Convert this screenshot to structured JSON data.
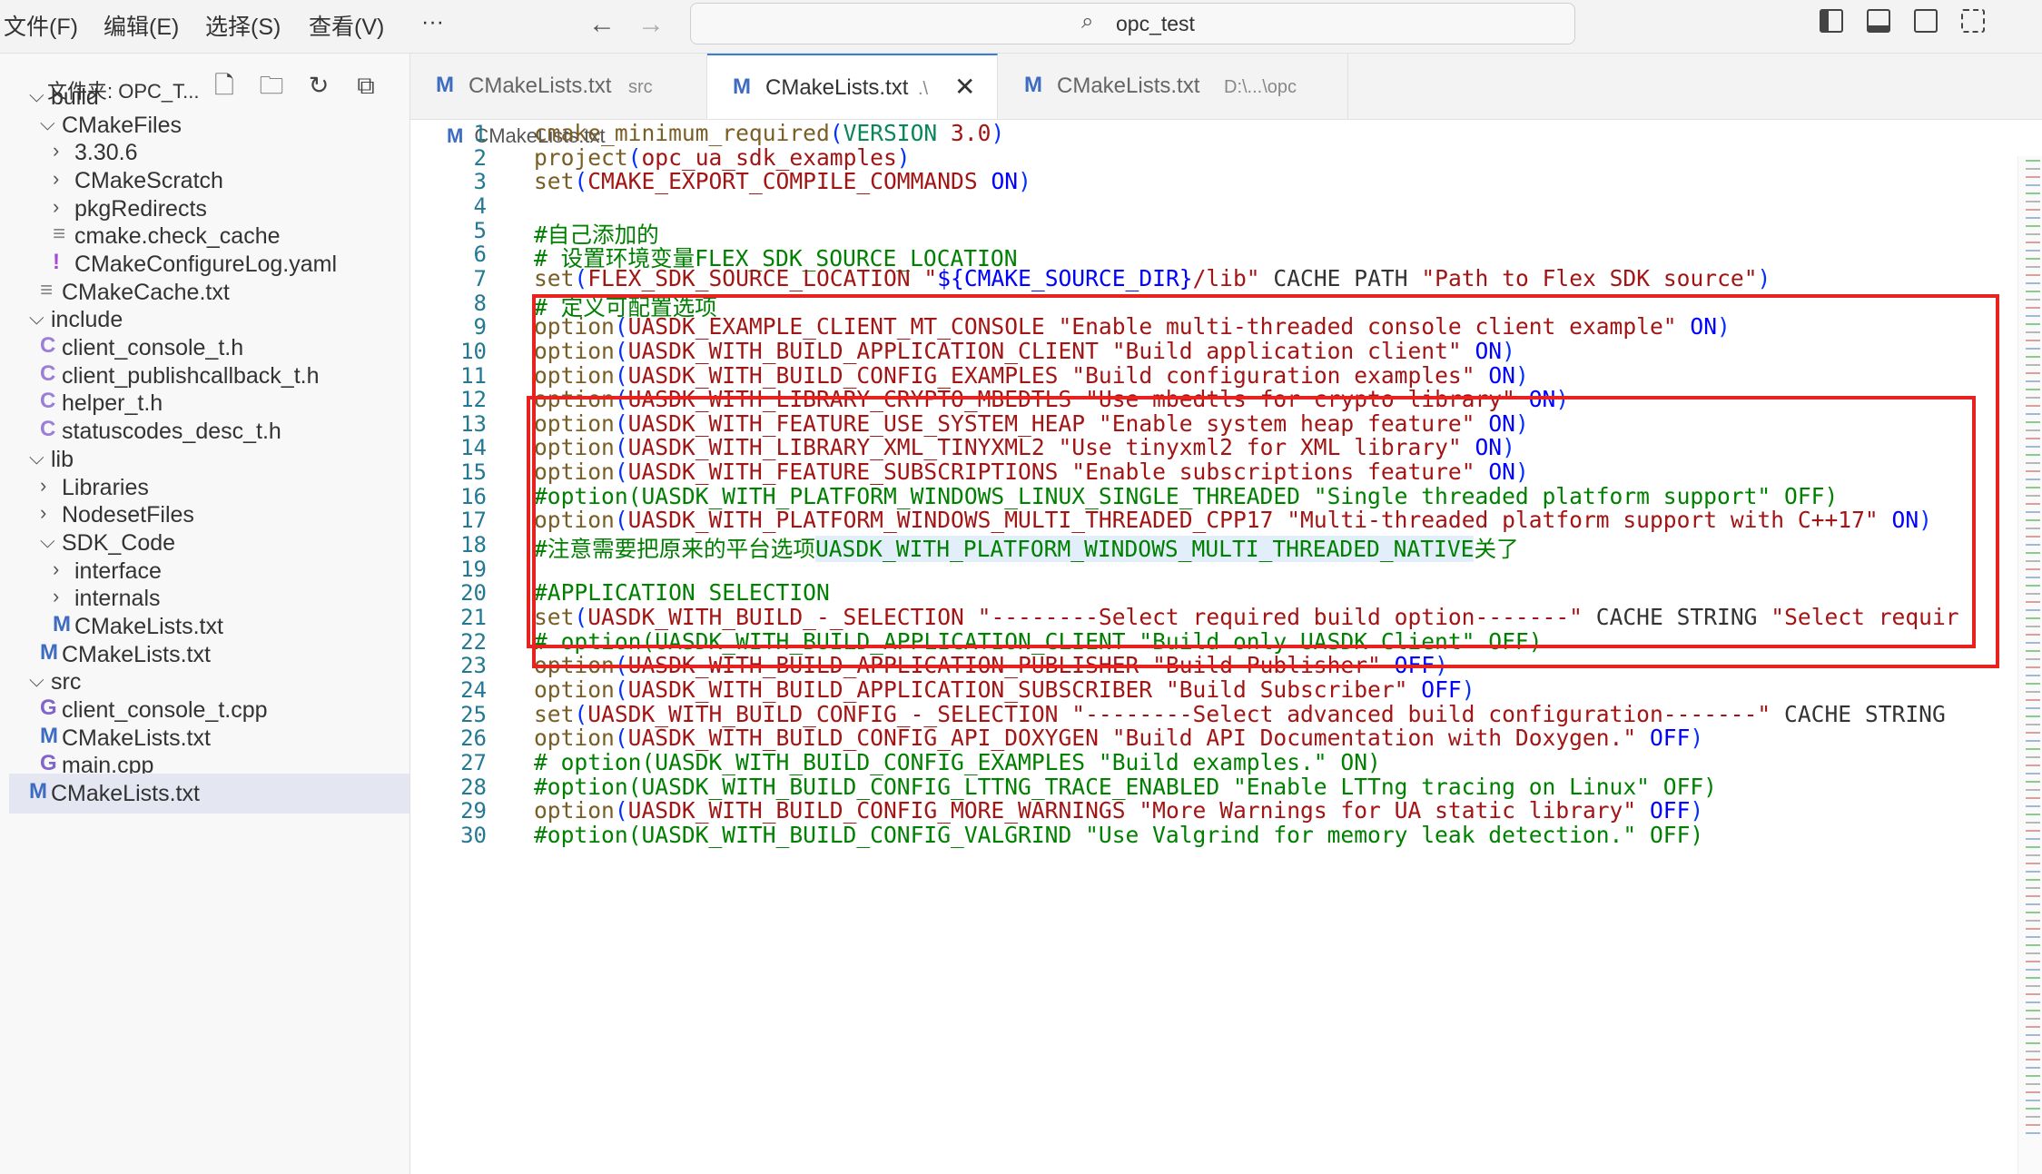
{
  "menu": [
    "文件(F)",
    "编辑(E)",
    "选择(S)",
    "查看(V)",
    "···"
  ],
  "search": {
    "text": "opc_test",
    "icon": "search-icon"
  },
  "sidebar": {
    "title": "文件夹: OPC_T...",
    "actions": [
      "new-file-icon",
      "new-folder-icon",
      "refresh-icon",
      "collapse-all-icon"
    ],
    "tree": [
      {
        "label": "build",
        "chevron": "⌵",
        "level": 0
      },
      {
        "label": "CMakeFiles",
        "chevron": "⌵",
        "level": 1
      },
      {
        "label": "3.30.6",
        "chevron": "›",
        "level": 2
      },
      {
        "label": "CMakeScratch",
        "chevron": "›",
        "level": 2
      },
      {
        "label": "pkgRedirects",
        "chevron": "›",
        "level": 2
      },
      {
        "label": "cmake.check_cache",
        "icon": "≡",
        "level": 2
      },
      {
        "label": "CMakeConfigureLog.yaml",
        "icon": "!",
        "level": 2
      },
      {
        "label": "CMakeCache.txt",
        "icon": "≡",
        "level": 1
      },
      {
        "label": "include",
        "chevron": "⌵",
        "level": 0
      },
      {
        "label": "client_console_t.h",
        "icon": "C",
        "level": 1
      },
      {
        "label": "client_publishcallback_t.h",
        "icon": "C",
        "level": 1
      },
      {
        "label": "helper_t.h",
        "icon": "C",
        "level": 1
      },
      {
        "label": "statuscodes_desc_t.h",
        "icon": "C",
        "level": 1
      },
      {
        "label": "lib",
        "chevron": "⌵",
        "level": 0
      },
      {
        "label": "Libraries",
        "chevron": "›",
        "level": 1
      },
      {
        "label": "NodesetFiles",
        "chevron": "›",
        "level": 1
      },
      {
        "label": "SDK_Code",
        "chevron": "⌵",
        "level": 1
      },
      {
        "label": "interface",
        "chevron": "›",
        "level": 2
      },
      {
        "label": "internals",
        "chevron": "›",
        "level": 2
      },
      {
        "label": "CMakeLists.txt",
        "icon": "M",
        "level": 2
      },
      {
        "label": "CMakeLists.txt",
        "icon": "M",
        "level": 1
      },
      {
        "label": "src",
        "chevron": "⌵",
        "level": 0
      },
      {
        "label": "client_console_t.cpp",
        "icon": "G",
        "level": 1
      },
      {
        "label": "CMakeLists.txt",
        "icon": "M",
        "level": 1
      },
      {
        "label": "main.cpp",
        "icon": "G",
        "level": 1
      },
      {
        "label": "CMakeLists.txt",
        "icon": "M",
        "level": 0
      }
    ]
  },
  "tabs": [
    {
      "icon": "M",
      "name": "CMakeLists.txt",
      "desc": "src",
      "active": false
    },
    {
      "icon": "M",
      "name": "CMakeLists.txt",
      "desc": ".\\",
      "active": true,
      "close": "✕"
    },
    {
      "icon": "M",
      "name": "CMakeLists.txt",
      "desc": "D:\\...\\opc",
      "active": false
    }
  ],
  "breadcrumb": {
    "icon": "M",
    "label": "CMakeLists.txt"
  },
  "editor": {
    "line_numbers": [
      "1",
      "2",
      "3",
      "4",
      "5",
      "6",
      "7",
      "8",
      "9",
      "10",
      "11",
      "12",
      "13",
      "14",
      "15",
      "16",
      "17",
      "18",
      "19",
      "20",
      "21",
      "22",
      "23",
      "24",
      "25",
      "26",
      "27",
      "28",
      "29",
      "30"
    ],
    "lines": [
      "cmake_minimum_required(VERSION 3.0)",
      "project(opc_ua_sdk_examples)",
      "set(CMAKE_EXPORT_COMPILE_COMMANDS ON)",
      "",
      "#自己添加的",
      "# 设置环境变量FLEX_SDK_SOURCE_LOCATION",
      "set(FLEX_SDK_SOURCE_LOCATION \"${CMAKE_SOURCE_DIR}/lib\" CACHE PATH \"Path to Flex SDK source\")",
      "# 定义可配置选项",
      "option(UASDK_EXAMPLE_CLIENT_MT_CONSOLE \"Enable multi-threaded console client example\" ON)",
      "option(UASDK_WITH_BUILD_APPLICATION_CLIENT \"Build application client\" ON)",
      "option(UASDK_WITH_BUILD_CONFIG_EXAMPLES \"Build configuration examples\" ON)",
      "option(UASDK_WITH_LIBRARY_CRYPTO_MBEDTLS \"Use mbedtls for crypto library\" ON)",
      "option(UASDK_WITH_FEATURE_USE_SYSTEM_HEAP \"Enable system heap feature\" ON)",
      "option(UASDK_WITH_LIBRARY_XML_TINYXML2 \"Use tinyxml2 for XML library\" ON)",
      "option(UASDK_WITH_FEATURE_SUBSCRIPTIONS \"Enable subscriptions feature\" ON)",
      "#option(UASDK_WITH_PLATFORM_WINDOWS_LINUX_SINGLE_THREADED \"Single threaded platform support\" OFF)",
      "option(UASDK_WITH_PLATFORM_WINDOWS_MULTI_THREADED_CPP17 \"Multi-threaded platform support with C++17\" ON)",
      "#注意需要把原来的平台选项UASDK_WITH_PLATFORM_WINDOWS_MULTI_THREADED_NATIVE关了",
      "",
      "#APPLICATION SELECTION",
      "set(UASDK_WITH_BUILD_-_SELECTION \"--------Select required build option-------\" CACHE STRING \"Select requir",
      "# option(UASDK_WITH_BUILD_APPLICATION_CLIENT \"Build only UASDK Client\" OFF)",
      "option(UASDK_WITH_BUILD_APPLICATION_PUBLISHER \"Build Publisher\" OFF)",
      "option(UASDK_WITH_BUILD_APPLICATION_SUBSCRIBER \"Build Subscriber\" OFF)",
      "set(UASDK_WITH_BUILD_CONFIG_-_SELECTION \"--------Select advanced build configuration-------\" CACHE STRING",
      "option(UASDK_WITH_BUILD_CONFIG_API_DOXYGEN \"Build API Documentation with Doxygen.\" OFF)",
      "# option(UASDK_WITH_BUILD_CONFIG_EXAMPLES \"Build examples.\" ON)",
      "#option(UASDK_WITH_BUILD_CONFIG_LTTNG_TRACE_ENABLED \"Enable LTTng tracing on Linux\" OFF)",
      "option(UASDK_WITH_BUILD_CONFIG_MORE_WARNINGS \"More Warnings for UA static library\" OFF)",
      "#option(UASDK_WITH_BUILD_CONFIG_VALGRIND \"Use Valgrind for memory leak detection.\" OFF)"
    ]
  },
  "colors": {
    "accent": "#3a7bd5",
    "annotation_box": "#e8221e",
    "comment": "#008000",
    "string": "#a31515",
    "keyword_blue": "#0000ff",
    "line_number": "#237893"
  }
}
